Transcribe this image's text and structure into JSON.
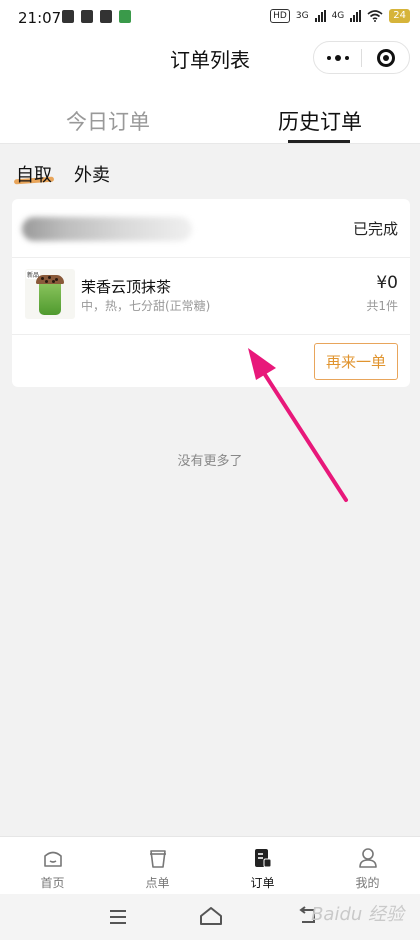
{
  "status_bar": {
    "time": "21:07",
    "hd_label": "HD",
    "net1_label": "3G",
    "net2_label": "4G",
    "battery": "24"
  },
  "header": {
    "title": "订单列表",
    "more_icon": "more-dots-icon",
    "close_icon": "target-close-icon"
  },
  "main_tabs": [
    {
      "label": "今日订单",
      "active": false
    },
    {
      "label": "历史订单",
      "active": true
    }
  ],
  "sub_tabs": [
    {
      "label": "自取",
      "active": true
    },
    {
      "label": "外卖",
      "active": false
    }
  ],
  "order": {
    "status": "已完成",
    "item": {
      "name": "茉香云顶抹茶",
      "spec": "中，热，七分甜(正常糖)",
      "price": "¥0",
      "count": "共1件",
      "image_badge": "新品"
    },
    "reorder_label": "再来一单"
  },
  "no_more_text": "没有更多了",
  "tabbar": [
    {
      "label": "首页",
      "icon": "home-icon",
      "active": false
    },
    {
      "label": "点单",
      "icon": "cup-icon",
      "active": false
    },
    {
      "label": "订单",
      "icon": "order-list-icon",
      "active": true
    },
    {
      "label": "我的",
      "icon": "user-icon",
      "active": false
    }
  ],
  "watermark": "Baidu 经验",
  "colors": {
    "accent_orange": "#e0942f",
    "annotation_arrow": "#e8187a",
    "background": "#f2f2f2"
  }
}
